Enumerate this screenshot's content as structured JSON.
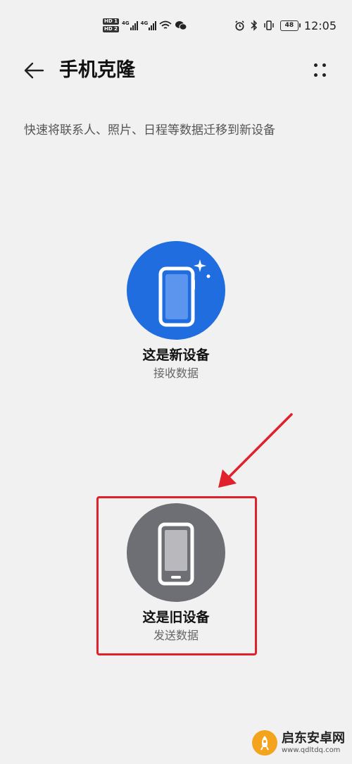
{
  "status_bar": {
    "hd1": "HD 1",
    "hd2": "HD 2",
    "net1": "4G",
    "net2": "4G",
    "battery": "48",
    "time": "12:05"
  },
  "app_bar": {
    "title": "手机克隆"
  },
  "subtitle": "快速将联系人、照片、日程等数据迁移到新设备",
  "options": {
    "new_device": {
      "title": "这是新设备",
      "subtitle": "接收数据",
      "color": "#1f6ddf"
    },
    "old_device": {
      "title": "这是旧设备",
      "subtitle": "发送数据",
      "color": "#6e6f75"
    }
  },
  "annotation": {
    "color": "#e0212b"
  },
  "watermark": {
    "name": "启东安卓网",
    "url": "www.qdltdq.com"
  },
  "icons": [
    "back-arrow-icon",
    "more-dots-icon",
    "new-phone-icon",
    "old-phone-icon",
    "alarm-icon",
    "bluetooth-icon",
    "vibrate-icon",
    "wifi-icon",
    "wechat-icon"
  ]
}
